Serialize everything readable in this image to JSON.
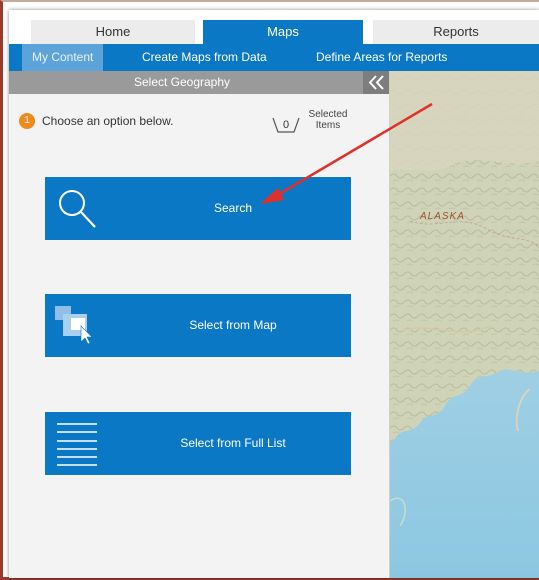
{
  "tabs": [
    {
      "label": "Home",
      "active": false
    },
    {
      "label": "Maps",
      "active": true
    },
    {
      "label": "Reports",
      "active": false
    }
  ],
  "subnav": [
    {
      "label": "My Content",
      "active": true
    },
    {
      "label": "Create Maps from Data",
      "active": false
    },
    {
      "label": "Define Areas for Reports",
      "active": false
    }
  ],
  "panel": {
    "title": "Select Geography",
    "collapse_icon": "double-chevron-left-icon",
    "step_number": "1",
    "instruction": "Choose an option below.",
    "selected_count": "0",
    "selected_label_line1": "Selected",
    "selected_label_line2": "Items"
  },
  "buttons": [
    {
      "label": "Search",
      "icon": "search-icon"
    },
    {
      "label": "Select from Map",
      "icon": "map-select-icon"
    },
    {
      "label": "Select from Full List",
      "icon": "list-icon"
    }
  ],
  "map": {
    "region_label": "ALASKA"
  },
  "colors": {
    "accent": "#0b78c5",
    "step_badge": "#f08a1c",
    "arrow": "#e0302a"
  }
}
